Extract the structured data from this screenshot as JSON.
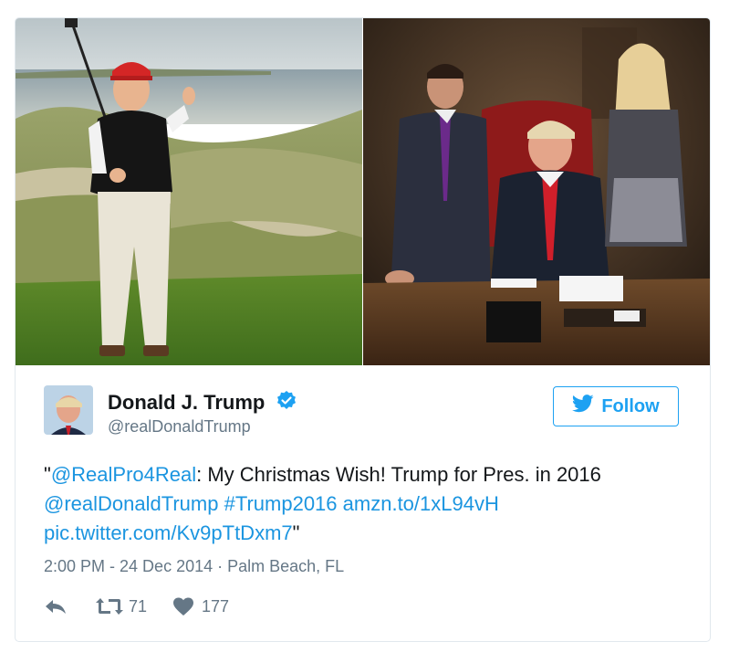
{
  "tweet": {
    "author_name": "Donald J. Trump",
    "author_handle": "@realDonaldTrump",
    "follow_label": "Follow",
    "text_quote_open": "\"",
    "mention_1": "@RealPro4Real",
    "text_body": ": My Christmas Wish! Trump for Pres. in 2016",
    "mention_2": "@realDonaldTrump",
    "hashtag": "#Trump2016",
    "link_1": "amzn.to/1xL94vH",
    "link_2": "pic.twitter.com/Kv9pTtDxm7",
    "text_quote_close": "\"",
    "timestamp": "2:00 PM - 24 Dec 2014",
    "location_sep": " · ",
    "location": "Palm Beach, FL",
    "retweet_count": "71",
    "like_count": "177"
  },
  "colors": {
    "accent": "#1da1f2",
    "link": "#1b95e0",
    "meta_gray": "#657786",
    "border": "#e1e8ed"
  },
  "icons": {
    "reply": "reply-icon",
    "retweet": "retweet-icon",
    "like": "heart-icon",
    "verified": "verified-badge-icon",
    "bird": "twitter-bird-icon"
  }
}
